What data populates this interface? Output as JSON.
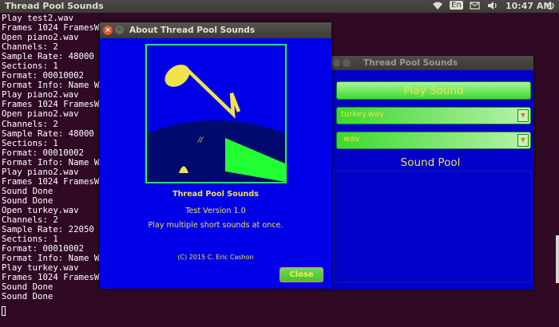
{
  "topbar": {
    "title": "Thread Pool Sounds",
    "keyboard_layout": "En",
    "time": "10:47 AM"
  },
  "terminal": {
    "lines": [
      "Play test2.wav",
      "Frames 1024 FramesW",
      "Open piano2.wav",
      "Channels: 2",
      "Sample Rate: 48000",
      "Sections: 1",
      "Format: 00010002",
      "Format Info: Name WAV",
      "Play piano2.wav",
      "Frames 1024 FramesW",
      "Open piano2.wav",
      "Channels: 2",
      "Sample Rate: 48000",
      "Sections: 1",
      "Format: 00010002",
      "Format Info: Name WAV",
      "Play piano2.wav",
      "Frames 1024 FramesW",
      "Sound Done",
      "Sound Done",
      "Open turkey.wav",
      "Channels: 2",
      "Sample Rate: 22050",
      "Sections: 1",
      "Format: 00010002",
      "Format Info: Name WAV",
      "Play turkey.wav",
      "Frames 1024 FramesW",
      "Sound Done",
      "Sound Done"
    ]
  },
  "main_window": {
    "title": "Thread Pool Sounds",
    "play_button": "Play Sound",
    "sound_select": "turkey.wav",
    "filter_select": ".wav",
    "pool_label": "Sound Pool"
  },
  "about_dialog": {
    "title": "About Thread Pool Sounds",
    "close_glyph": "×",
    "minimize_glyph": "–",
    "app_name": "Thread Pool Sounds",
    "version": "Test Version 1.0",
    "description": "Play multiple short sounds at once.",
    "copyright": "(C) 2015 C. Eric Cashon",
    "close_button": "Close"
  },
  "colors": {
    "terminal_bg": "#300a24",
    "window_blue": "#0000e8",
    "accent_yellow": "#f0e24a",
    "accent_green": "#3dd92e"
  },
  "icons": [
    "wifi-icon",
    "keyboard-layout-indicator",
    "mail-icon",
    "volume-icon",
    "power-icon",
    "window-close-icon",
    "window-minimize-icon",
    "combo-arrow-icon"
  ]
}
